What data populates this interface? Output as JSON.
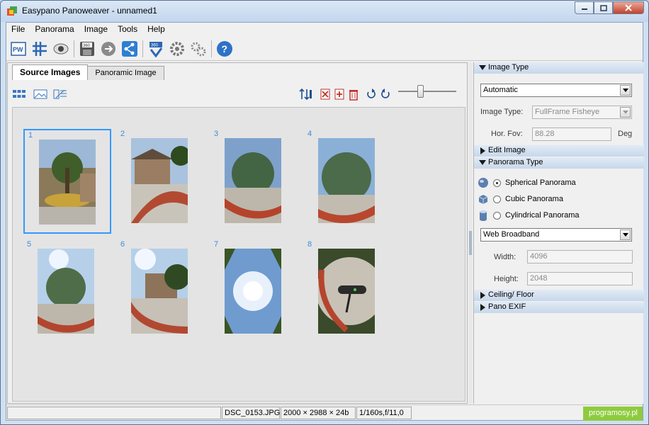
{
  "window": {
    "title": "Easypano Panoweaver - unnamed1"
  },
  "menu": [
    "File",
    "Panorama",
    "Image",
    "Tools",
    "Help"
  ],
  "toolbar": {
    "buttons": [
      "new-project-icon",
      "stitch-icon",
      "preview-icon",
      "save-icon",
      "publish-icon",
      "share-icon",
      "batch-icon",
      "settings-icon",
      "gears-icon",
      "help-icon"
    ]
  },
  "tabs": [
    "Source Images",
    "Panoramic Image"
  ],
  "images": [
    {
      "num": "1"
    },
    {
      "num": "2"
    },
    {
      "num": "3"
    },
    {
      "num": "4"
    },
    {
      "num": "5"
    },
    {
      "num": "6"
    },
    {
      "num": "7"
    },
    {
      "num": "8"
    }
  ],
  "sections": {
    "image_type": "Image Type",
    "edit_image": "Edit Image",
    "panorama_type": "Panorama Type",
    "ceiling_floor": "Ceiling/ Floor",
    "pano_exif": "Pano EXIF"
  },
  "image_type_panel": {
    "mode_value": "Automatic",
    "type_label": "Image Type:",
    "type_value": "FullFrame Fisheye",
    "fov_label": "Hor. Fov:",
    "fov_value": "88.28",
    "fov_unit": "Deg"
  },
  "panorama_panel": {
    "options": [
      "Spherical Panorama",
      "Cubic Panorama",
      "Cylindrical Panorama"
    ],
    "selected": "Spherical Panorama",
    "preset_value": "Web Broadband",
    "width_label": "Width:",
    "width_value": "4096",
    "height_label": "Height:",
    "height_value": "2048"
  },
  "status": {
    "filename": "DSC_0153.JPG",
    "dimensions": "2000 × 2988 × 24b",
    "exposure": "1/160s,f/11,0",
    "watermark": "programosy.pl"
  },
  "colors": {
    "accent": "#3399ff",
    "section_header": "#c7d7ea",
    "watermark_bg": "#8ecb3e"
  }
}
